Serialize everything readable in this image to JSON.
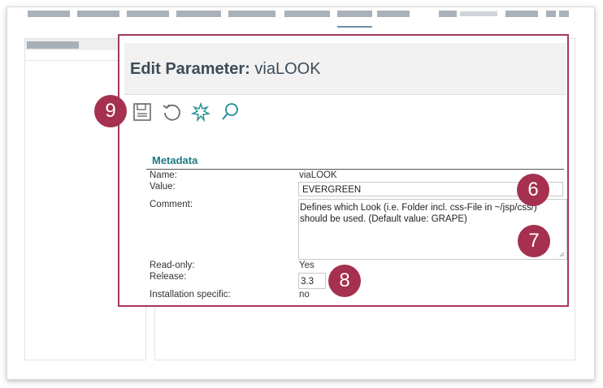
{
  "dialog": {
    "title_prefix": "Edit Parameter:",
    "title_value": "viaLOOK"
  },
  "toolbar": {
    "icons": [
      "save-icon",
      "undo-icon",
      "sparkle-icon",
      "search-icon"
    ]
  },
  "metadata": {
    "section_title": "Metadata",
    "name_label": "Name:",
    "name_value": "viaLOOK",
    "value_label": "Value:",
    "value_value": "EVERGREEN",
    "comment_label": "Comment:",
    "comment_value": "Defines which Look (i.e. Folder incl. css-File in ~/jsp/css/) should be used. (Default value: GRAPE)",
    "readonly_label": "Read-only:",
    "readonly_value": "Yes",
    "release_label": "Release:",
    "release_value": "3.3",
    "install_label": "Installation specific:",
    "install_value": "no"
  },
  "callouts": {
    "value_field": "6",
    "comment_field": "7",
    "release_field": "8",
    "toolbar": "9"
  },
  "colors": {
    "accent_border": "#a5395b",
    "badge": "#a5304f",
    "section_title": "#1c7a83",
    "icon_teal": "#1f8b94"
  }
}
